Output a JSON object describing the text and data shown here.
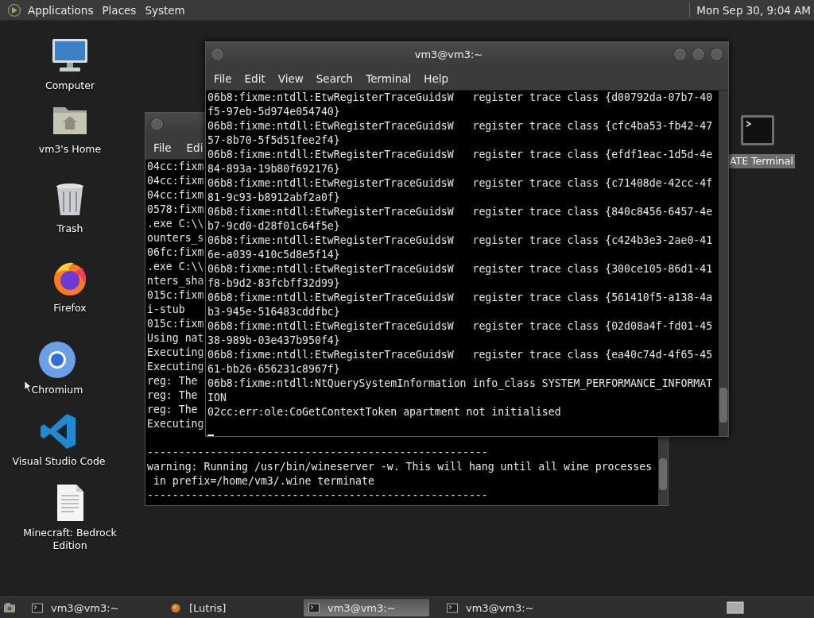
{
  "top_panel": {
    "menus": [
      "Applications",
      "Places",
      "System"
    ],
    "clock": "Mon Sep 30, 9:04 AM"
  },
  "desktop_icons": [
    {
      "label": "Computer",
      "kind": "computer",
      "selected": false
    },
    {
      "label": "vm3's Home",
      "kind": "home",
      "selected": false
    },
    {
      "label": "Trash",
      "kind": "trash",
      "selected": false
    },
    {
      "label": "Firefox",
      "kind": "firefox",
      "selected": false
    },
    {
      "label": "Chromium",
      "kind": "chromium",
      "selected": false
    },
    {
      "label": "Visual Studio Code",
      "kind": "vscode",
      "selected": false
    },
    {
      "label": "Minecraft: Bedrock Edition",
      "kind": "document",
      "selected": false
    },
    {
      "label": "ATE Terminal",
      "kind": "terminal",
      "selected": true
    }
  ],
  "back_window": {
    "menus": [
      "File",
      "Edi"
    ],
    "lines_left": [
      "04cc:fixm",
      "04cc:fixm",
      "04cc:fixm",
      "0578:fixm",
      ".exe C:\\\\",
      "ounters_s",
      "06fc:fixm",
      ".exe C:\\\\",
      "nters_sha",
      "015c:fixm",
      "i-stub",
      "015c:fixm",
      "Using nat",
      "Executing",
      "Executing",
      "reg: The",
      "reg: The",
      "reg: The",
      "Executing"
    ],
    "lines": [
      "------------------------------------------------------",
      "warning: Running /usr/bin/wineserver -w. This will hang until all wine processes",
      " in prefix=/home/vm3/.wine terminate",
      "------------------------------------------------------"
    ]
  },
  "front_window": {
    "title": "vm3@vm3:~",
    "menus": [
      "File",
      "Edit",
      "View",
      "Search",
      "Terminal",
      "Help"
    ],
    "lines": [
      "06b8:fixme:ntdll:EtwRegisterTraceGuidsW   register trace class {d00792da-07b7-40",
      "f5-97eb-5d974e054740}",
      "06b8:fixme:ntdll:EtwRegisterTraceGuidsW   register trace class {cfc4ba53-fb42-47",
      "57-8b70-5f5d51fee2f4}",
      "06b8:fixme:ntdll:EtwRegisterTraceGuidsW   register trace class {efdf1eac-1d5d-4e",
      "84-893a-19b80f692176}",
      "06b8:fixme:ntdll:EtwRegisterTraceGuidsW   register trace class {c71408de-42cc-4f",
      "81-9c93-b8912abf2a0f}",
      "06b8:fixme:ntdll:EtwRegisterTraceGuidsW   register trace class {840c8456-6457-4e",
      "b7-9cd0-d28f01c64f5e}",
      "06b8:fixme:ntdll:EtwRegisterTraceGuidsW   register trace class {c424b3e3-2ae0-41",
      "6e-a039-410c5d8e5f14}",
      "06b8:fixme:ntdll:EtwRegisterTraceGuidsW   register trace class {300ce105-86d1-41",
      "f8-b9d2-83fcbff32d99}",
      "06b8:fixme:ntdll:EtwRegisterTraceGuidsW   register trace class {561410f5-a138-4a",
      "b3-945e-516483cddfbc}",
      "06b8:fixme:ntdll:EtwRegisterTraceGuidsW   register trace class {02d08a4f-fd01-45",
      "38-989b-03e437b950f4}",
      "06b8:fixme:ntdll:EtwRegisterTraceGuidsW   register trace class {ea40c74d-4f65-45",
      "61-bb26-656231c8967f}",
      "06b8:fixme:ntdll:NtQuerySystemInformation info_class SYSTEM_PERFORMANCE_INFORMAT",
      "ION",
      "02cc:err:ole:CoGetContextToken apartment not initialised"
    ]
  },
  "taskbar": {
    "items": [
      {
        "label": "vm3@vm3:~",
        "kind": "terminal",
        "selected": false
      },
      {
        "label": "[Lutris]",
        "kind": "lutris",
        "selected": false
      },
      {
        "label": "vm3@vm3:~",
        "kind": "terminal",
        "selected": true
      },
      {
        "label": "vm3@vm3:~",
        "kind": "terminal",
        "selected": false
      }
    ]
  }
}
